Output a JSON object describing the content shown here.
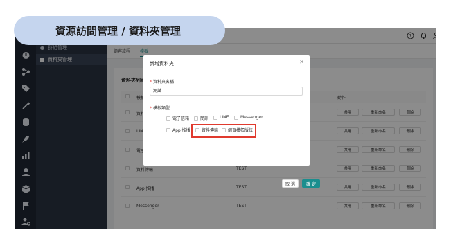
{
  "banner": {
    "title": "資源訪問管理 / 資料夾管理"
  },
  "sidebar": {
    "items": [
      {
        "label": "群組管理"
      },
      {
        "label": "資料夾管理"
      }
    ]
  },
  "tabs": [
    {
      "label": "顧客旅程"
    },
    {
      "label": "模板"
    }
  ],
  "card": {
    "title": "資料夾列表",
    "columns": {
      "type": "模板類型",
      "actions": "動作"
    },
    "rows": [
      {
        "type": "資料傳輸",
        "name": ""
      },
      {
        "type": "LINE",
        "name": ""
      },
      {
        "type": "電子信箱",
        "name": ""
      },
      {
        "type": "資料傳輸",
        "name": "TEST"
      },
      {
        "type": "App 推播",
        "name": "TEST"
      },
      {
        "type": "Messenger",
        "name": "TEST"
      }
    ],
    "actions": {
      "share": "共用",
      "rename": "重新命名",
      "delete": "刪除"
    }
  },
  "modal": {
    "title": "新增資料夾",
    "name_label": "資料夾名稱",
    "name_value": "測試",
    "type_label": "模板類型",
    "options": [
      {
        "label": "電子信箱"
      },
      {
        "label": "簡訊"
      },
      {
        "label": "LINE"
      },
      {
        "label": "Messenger"
      },
      {
        "label": "App 推播"
      },
      {
        "label": "資料傳輸"
      },
      {
        "label": "網頁橫幅版位"
      }
    ],
    "cancel_label": "取 消",
    "ok_label": "確 定"
  },
  "colors": {
    "accent": "#1b8e8e",
    "highlight": "#e03a2e",
    "sidebar": "#2a3342",
    "banner": "#c5d5ee"
  },
  "icons": [
    "help-icon",
    "bell-icon",
    "user-icon",
    "close-icon"
  ]
}
